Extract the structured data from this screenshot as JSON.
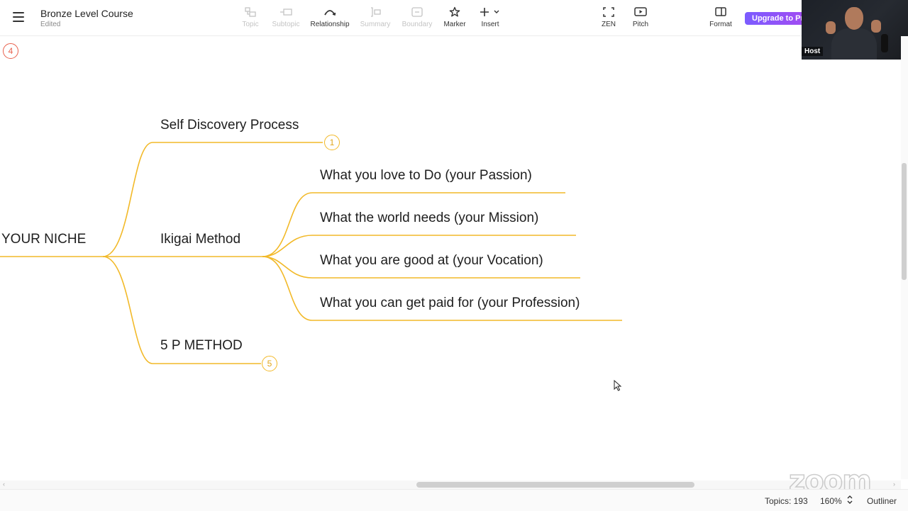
{
  "header": {
    "title": "Bronze Level Course",
    "status": "Edited"
  },
  "toolbar": {
    "tools": [
      {
        "label": "Topic",
        "icon": "topic-icon",
        "enabled": false
      },
      {
        "label": "Subtopic",
        "icon": "subtopic-icon",
        "enabled": false
      },
      {
        "label": "Relationship",
        "icon": "relationship-icon",
        "enabled": true
      },
      {
        "label": "Summary",
        "icon": "summary-icon",
        "enabled": false
      },
      {
        "label": "Boundary",
        "icon": "boundary-icon",
        "enabled": false
      },
      {
        "label": "Marker",
        "icon": "star-icon",
        "enabled": true
      },
      {
        "label": "Insert",
        "icon": "plus-icon",
        "enabled": true
      },
      {
        "label": "ZEN",
        "icon": "zen-fullscreen-icon",
        "enabled": true
      },
      {
        "label": "Pitch",
        "icon": "pitch-play-icon",
        "enabled": true
      },
      {
        "label": "Format",
        "icon": "format-panel-icon",
        "enabled": true
      }
    ],
    "upgrade_label": "Upgrade to Pro"
  },
  "video": {
    "host_label": "Host"
  },
  "mindmap": {
    "root": "YOUR NICHE",
    "top_badge": "4",
    "branches": [
      {
        "label": "Self Discovery Process",
        "badge": "1"
      },
      {
        "label": "Ikigai Method"
      },
      {
        "label": "5 P METHOD",
        "badge": "5"
      }
    ],
    "ikigai_children": [
      "What you love to Do (your Passion)",
      "What the world needs (your Mission)",
      "What you are good at (your Vocation)",
      "What you can get paid for (your Profession)"
    ]
  },
  "statusbar": {
    "topics": "Topics: 193",
    "zoom": "160%",
    "outliner": "Outliner"
  },
  "watermark": "zoom",
  "colors": {
    "branch_line": "#f2b928",
    "upgrade_gradient_start": "#7b5cff",
    "upgrade_gradient_end": "#a14cf2",
    "badge_red": "#e8604c"
  }
}
